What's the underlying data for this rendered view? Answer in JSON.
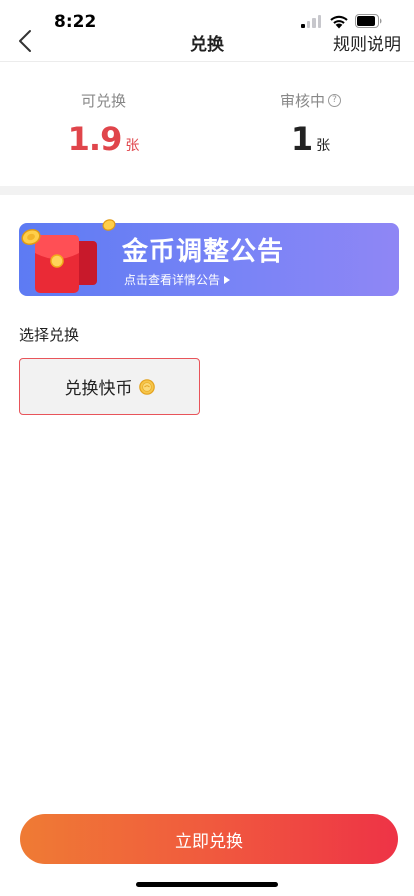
{
  "status_bar": {
    "time": "8:22",
    "signal_bars_on": 1,
    "icons": [
      "cellular-signal-icon",
      "wifi-icon",
      "battery-icon"
    ]
  },
  "nav": {
    "back_icon": "chevron-left-icon",
    "title": "兑换",
    "rules_label": "规则说明"
  },
  "stats": {
    "available": {
      "label": "可兑换",
      "value": "1.9",
      "unit": "张"
    },
    "reviewing": {
      "label": "审核中",
      "value": "1",
      "unit": "张",
      "help_icon": "question-circle-icon",
      "help_glyph": "?"
    }
  },
  "banner": {
    "title": "金币调整公告",
    "subtitle": "点击查看详情公告",
    "art": "red-envelope-with-coins",
    "arrow_icon": "caret-right-icon"
  },
  "select": {
    "label": "选择兑换",
    "options": [
      {
        "label": "兑换快币",
        "icon": "gold-coin-icon",
        "selected": true
      }
    ]
  },
  "cta": {
    "label": "立即兑换"
  },
  "colors": {
    "accent_red": "#e0454b",
    "banner_blue": "#5d7bf3",
    "cta_orange": "#ef7b34",
    "cta_red": "#ee3346"
  }
}
